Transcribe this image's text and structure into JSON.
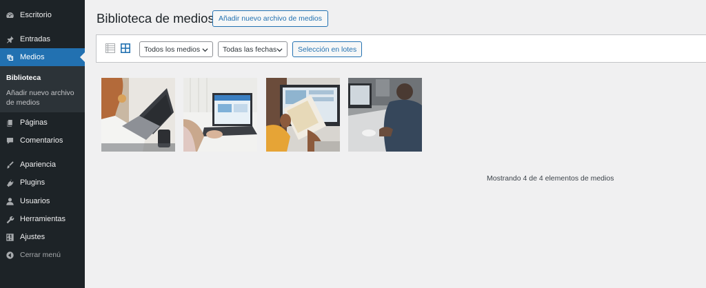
{
  "sidebar": {
    "items": [
      {
        "label": "Escritorio",
        "icon": "dashboard-icon"
      },
      {
        "label": "Entradas",
        "icon": "pin-icon"
      },
      {
        "label": "Medios",
        "icon": "media-icon",
        "active": true
      },
      {
        "label": "Páginas",
        "icon": "pages-icon"
      },
      {
        "label": "Comentarios",
        "icon": "comment-icon"
      },
      {
        "label": "Apariencia",
        "icon": "brush-icon"
      },
      {
        "label": "Plugins",
        "icon": "plugin-icon"
      },
      {
        "label": "Usuarios",
        "icon": "user-icon"
      },
      {
        "label": "Herramientas",
        "icon": "wrench-icon"
      },
      {
        "label": "Ajustes",
        "icon": "settings-icon"
      },
      {
        "label": "Cerrar menú",
        "icon": "collapse-icon"
      }
    ],
    "submenu": {
      "current": "Biblioteca",
      "add_new_line1": "Añadir nuevo archivo",
      "add_new_line2": "de medios"
    }
  },
  "main": {
    "title": "Biblioteca de medios",
    "add_new_label": "Añadir nuevo archivo de medios",
    "toolbar": {
      "type_filter": "Todos los medios",
      "date_filter": "Todas las fechas",
      "bulk_select": "Selección en lotes"
    },
    "thumbnails": [
      {
        "name": "media-item-1"
      },
      {
        "name": "media-item-2"
      },
      {
        "name": "media-item-3"
      },
      {
        "name": "media-item-4"
      }
    ],
    "count_text": "Mostrando 4 de 4 elementos de medios"
  },
  "colors": {
    "sidebar_bg": "#1d2327",
    "accent": "#2271b1",
    "page_bg": "#f0f0f1"
  }
}
